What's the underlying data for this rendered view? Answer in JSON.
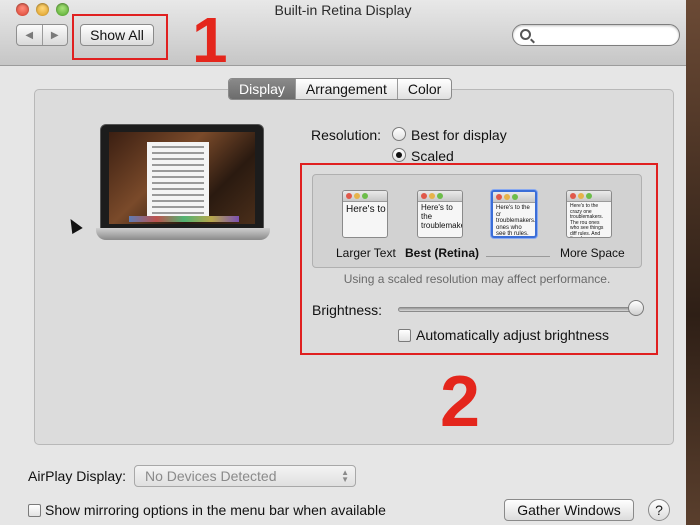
{
  "window": {
    "title": "Built-in Retina Display"
  },
  "toolbar": {
    "back_icon": "back-arrow-icon",
    "forward_icon": "forward-arrow-icon",
    "show_all_label": "Show All",
    "search_placeholder": ""
  },
  "annotations": {
    "marker_1": "1",
    "marker_2": "2",
    "highlight_color": "#e02020"
  },
  "tabs": [
    {
      "label": "Display",
      "active": true
    },
    {
      "label": "Arrangement",
      "active": false
    },
    {
      "label": "Color",
      "active": false
    }
  ],
  "resolution": {
    "label": "Resolution:",
    "options": [
      {
        "label": "Best for display",
        "selected": false
      },
      {
        "label": "Scaled",
        "selected": true
      }
    ]
  },
  "scaled_options": [
    {
      "label": "Larger Text",
      "preview": "Here's to troublem",
      "selected": false
    },
    {
      "label": "Best (Retina)",
      "preview": "Here's to the troublemakers.",
      "selected": false
    },
    {
      "label": "",
      "preview": "Here's to the cr troublemakers. ones who see th rules. And they",
      "selected": true
    },
    {
      "label": "More Space",
      "preview": "Here's to the crazy one troublemakers. The rou ones who see things diff rules. And they have no can quote them, disagree",
      "selected": false
    }
  ],
  "scaled_note": "Using a scaled resolution may affect performance.",
  "brightness": {
    "label": "Brightness:",
    "value": 1.0,
    "auto_label": "Automatically adjust brightness",
    "auto_checked": false
  },
  "airplay": {
    "label": "AirPlay Display:",
    "value": "No Devices Detected"
  },
  "mirroring": {
    "label": "Show mirroring options in the menu bar when available",
    "checked": false
  },
  "gather_label": "Gather Windows",
  "help_label": "?"
}
